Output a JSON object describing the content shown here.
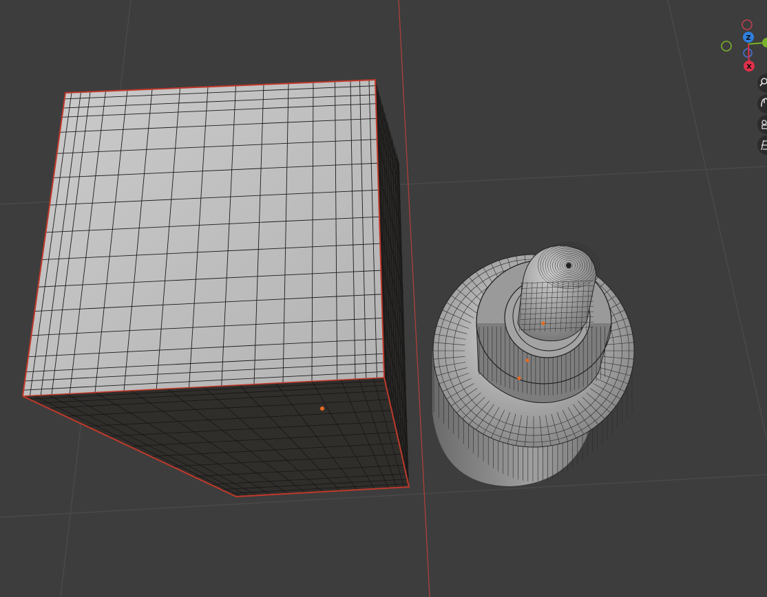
{
  "viewport": {
    "background_color": "#3d3d3d",
    "grid_line_color": "#4a4a4a",
    "x_axis_line_color": "#c0392b"
  },
  "objects": [
    {
      "name": "Cube",
      "type": "mesh",
      "wireframe": true,
      "selected": true,
      "outline_color": "#c0392b",
      "face_top_color": "#b9b9b9",
      "face_side_color": "#2f2d2a"
    },
    {
      "name": "Bottle",
      "type": "mesh",
      "wireframe": true,
      "selected": false,
      "face_color": "#9a9a9a"
    }
  ],
  "origin_point_color": "#e86a1f",
  "nav_gizmo": {
    "axes": [
      {
        "key": "z",
        "label": "Z",
        "color": "#2f7fe0"
      },
      {
        "key": "x",
        "label": "X",
        "color": "#e0304a"
      },
      {
        "key": "y",
        "label": "",
        "color": "#7ab32a"
      }
    ]
  },
  "nav_tools": [
    {
      "icon": "zoom-icon"
    },
    {
      "icon": "hand-pan-icon"
    },
    {
      "icon": "camera-icon"
    },
    {
      "icon": "grid-toggle-icon"
    }
  ]
}
